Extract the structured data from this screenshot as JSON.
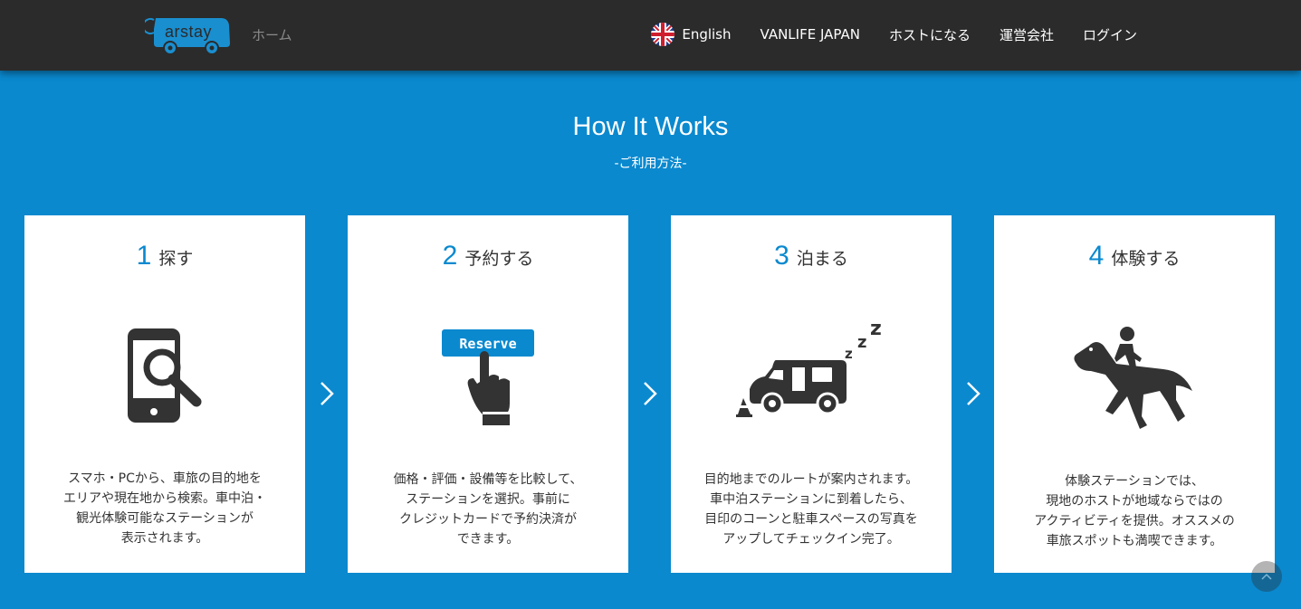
{
  "header": {
    "logo_text": "Carstay",
    "home_label": "ホーム",
    "nav": [
      {
        "label": "English",
        "icon": "uk-flag-icon"
      },
      {
        "label": "VANLIFE JAPAN"
      },
      {
        "label": "ホストになる"
      },
      {
        "label": "運営会社"
      },
      {
        "label": "ログイン"
      }
    ]
  },
  "section": {
    "title": "How It Works",
    "subtitle": "-ご利用方法-"
  },
  "steps": [
    {
      "number": "1",
      "title": "探す",
      "icon": "phone-search-icon",
      "description": "スマホ・PCから、車旅の目的地を\nエリアや現在地から検索。車中泊・\n観光体験可能なステーションが\n表示されます。"
    },
    {
      "number": "2",
      "title": "予約する",
      "icon": "reserve-hand-icon",
      "icon_label": "Reserve",
      "description": "価格・評価・設備等を比較して、\nステーションを選択。事前に\nクレジットカードで予約決済が\nできます。"
    },
    {
      "number": "3",
      "title": "泊まる",
      "icon": "camper-sleep-icon",
      "description": "目的地までのルートが案内されます。\n車中泊ステーションに到着したら、\n目印のコーンと駐車スペースの写真を\nアップしてチェックイン完了。"
    },
    {
      "number": "4",
      "title": "体験する",
      "icon": "horse-rider-icon",
      "description": "体験ステーションでは、\n現地のホストが地域ならではの\nアクティビティを提供。オススメの\n車旅スポットも満喫できます。"
    }
  ],
  "colors": {
    "accent": "#0a89cf",
    "header_bg": "#2b2b2b",
    "card_bg": "#ffffff"
  }
}
